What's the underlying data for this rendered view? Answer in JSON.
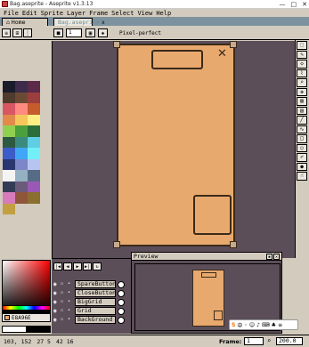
{
  "window": {
    "title": "Bag.aseprite - Aseprite v1.3.13",
    "minimize": "—",
    "maximize": "□",
    "close": "✕"
  },
  "menu": [
    "File",
    "Edit",
    "Sprite",
    "Layer",
    "Frame",
    "Select",
    "View",
    "Help"
  ],
  "tabs": {
    "home": "Home",
    "file": "Bag.aseprite",
    "close": "x"
  },
  "toolbar": {
    "brush_size": "1",
    "pixel_perfect": "Pixel-perfect"
  },
  "palette": {
    "colors": [
      "#1a1c2c",
      "#3d2c4a",
      "#5c2a49",
      "#4f3a2c",
      "#6b4a35",
      "#9c3e3e",
      "#d95763",
      "#ff8a80",
      "#c65b2c",
      "#e28a4a",
      "#f5c65b",
      "#ffee83",
      "#8fd14f",
      "#4aa03c",
      "#2b6e3a",
      "#2e5941",
      "#3c8a7e",
      "#5fcde4",
      "#3b5dc9",
      "#41a6f6",
      "#73eff7",
      "#29366f",
      "#7d86c6",
      "#b8c4f0",
      "#f4f4f4",
      "#94b0c2",
      "#566c86",
      "#333c57",
      "#6b5b7b",
      "#9b59b6",
      "#d77bba",
      "#8f563b",
      "#8a6f30",
      "#c2a042"
    ],
    "buttons": [
      "≡",
      "⊞",
      "⋮"
    ]
  },
  "color": {
    "hex": "E8A96E",
    "fg": "#ffffff",
    "bg": "#000000"
  },
  "timeline": {
    "buttons": [
      "|◀",
      "◀",
      "▶",
      "▶|",
      "↻"
    ],
    "layers": [
      "SpareButton",
      "CloseButton",
      "BigGrid",
      "Grid",
      "BackGround"
    ]
  },
  "preview": {
    "title": "Preview"
  },
  "status": {
    "position": "103, 152",
    "size": "27 5",
    "sel": "42 16",
    "frame_label": "Frame:",
    "frame_value": "1",
    "zoom": "200.0"
  },
  "ime": {
    "logo": "S",
    "zh": "中"
  },
  "colors": {
    "sprite_fill": "#e8a96e",
    "sprite_outline": "#3b2a1a",
    "canvas_bg": "#5c4e59",
    "ui_bg": "#d3cbbe"
  }
}
